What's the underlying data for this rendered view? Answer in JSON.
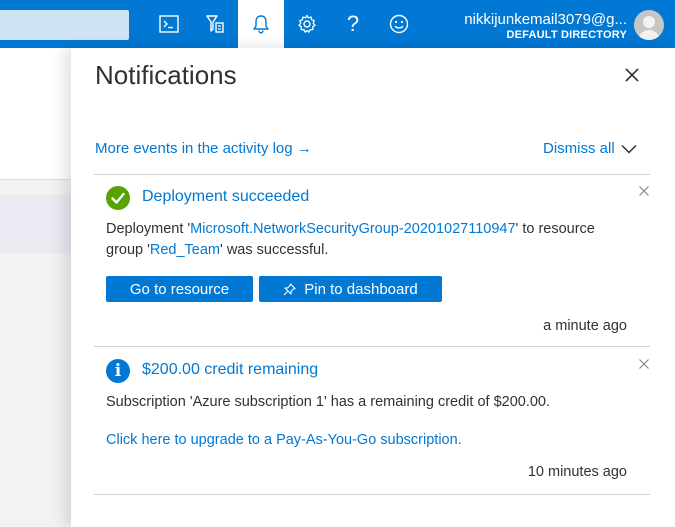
{
  "topbar": {
    "icons": [
      "cloud-shell-icon",
      "directory-filter-icon",
      "notifications-bell-icon",
      "settings-gear-icon",
      "help-icon",
      "feedback-smiley-icon"
    ],
    "help_glyph": "?",
    "account_email": "nikkijunkemail3079@g...",
    "account_directory": "DEFAULT DIRECTORY"
  },
  "panel": {
    "title": "Notifications",
    "activity_link": "More events in the activity log",
    "activity_arrow": "→",
    "dismiss_all": "Dismiss all"
  },
  "notifications": [
    {
      "status": "success",
      "title": "Deployment succeeded",
      "text_prefix": "Deployment '",
      "deployment_name": "Microsoft.NetworkSecurityGroup-20201027110947",
      "text_mid": "' to resource group '",
      "resource_group": "Red_Team",
      "text_suffix": "' was successful.",
      "buttons": {
        "go_to_resource": "Go to resource",
        "pin_to_dashboard": "Pin to dashboard",
        "pin_glyph": "📌"
      },
      "time": "a minute ago"
    },
    {
      "status": "info",
      "icon_glyph": "i",
      "title": "$200.00 credit remaining",
      "text": "Subscription 'Azure subscription 1' has a remaining credit of $200.00.",
      "link": "Click here to upgrade to a Pay-As-You-Go subscription.",
      "time": "10 minutes ago"
    }
  ],
  "colors": {
    "accent": "#0078d4",
    "success": "#57a300",
    "text": "#323130"
  }
}
